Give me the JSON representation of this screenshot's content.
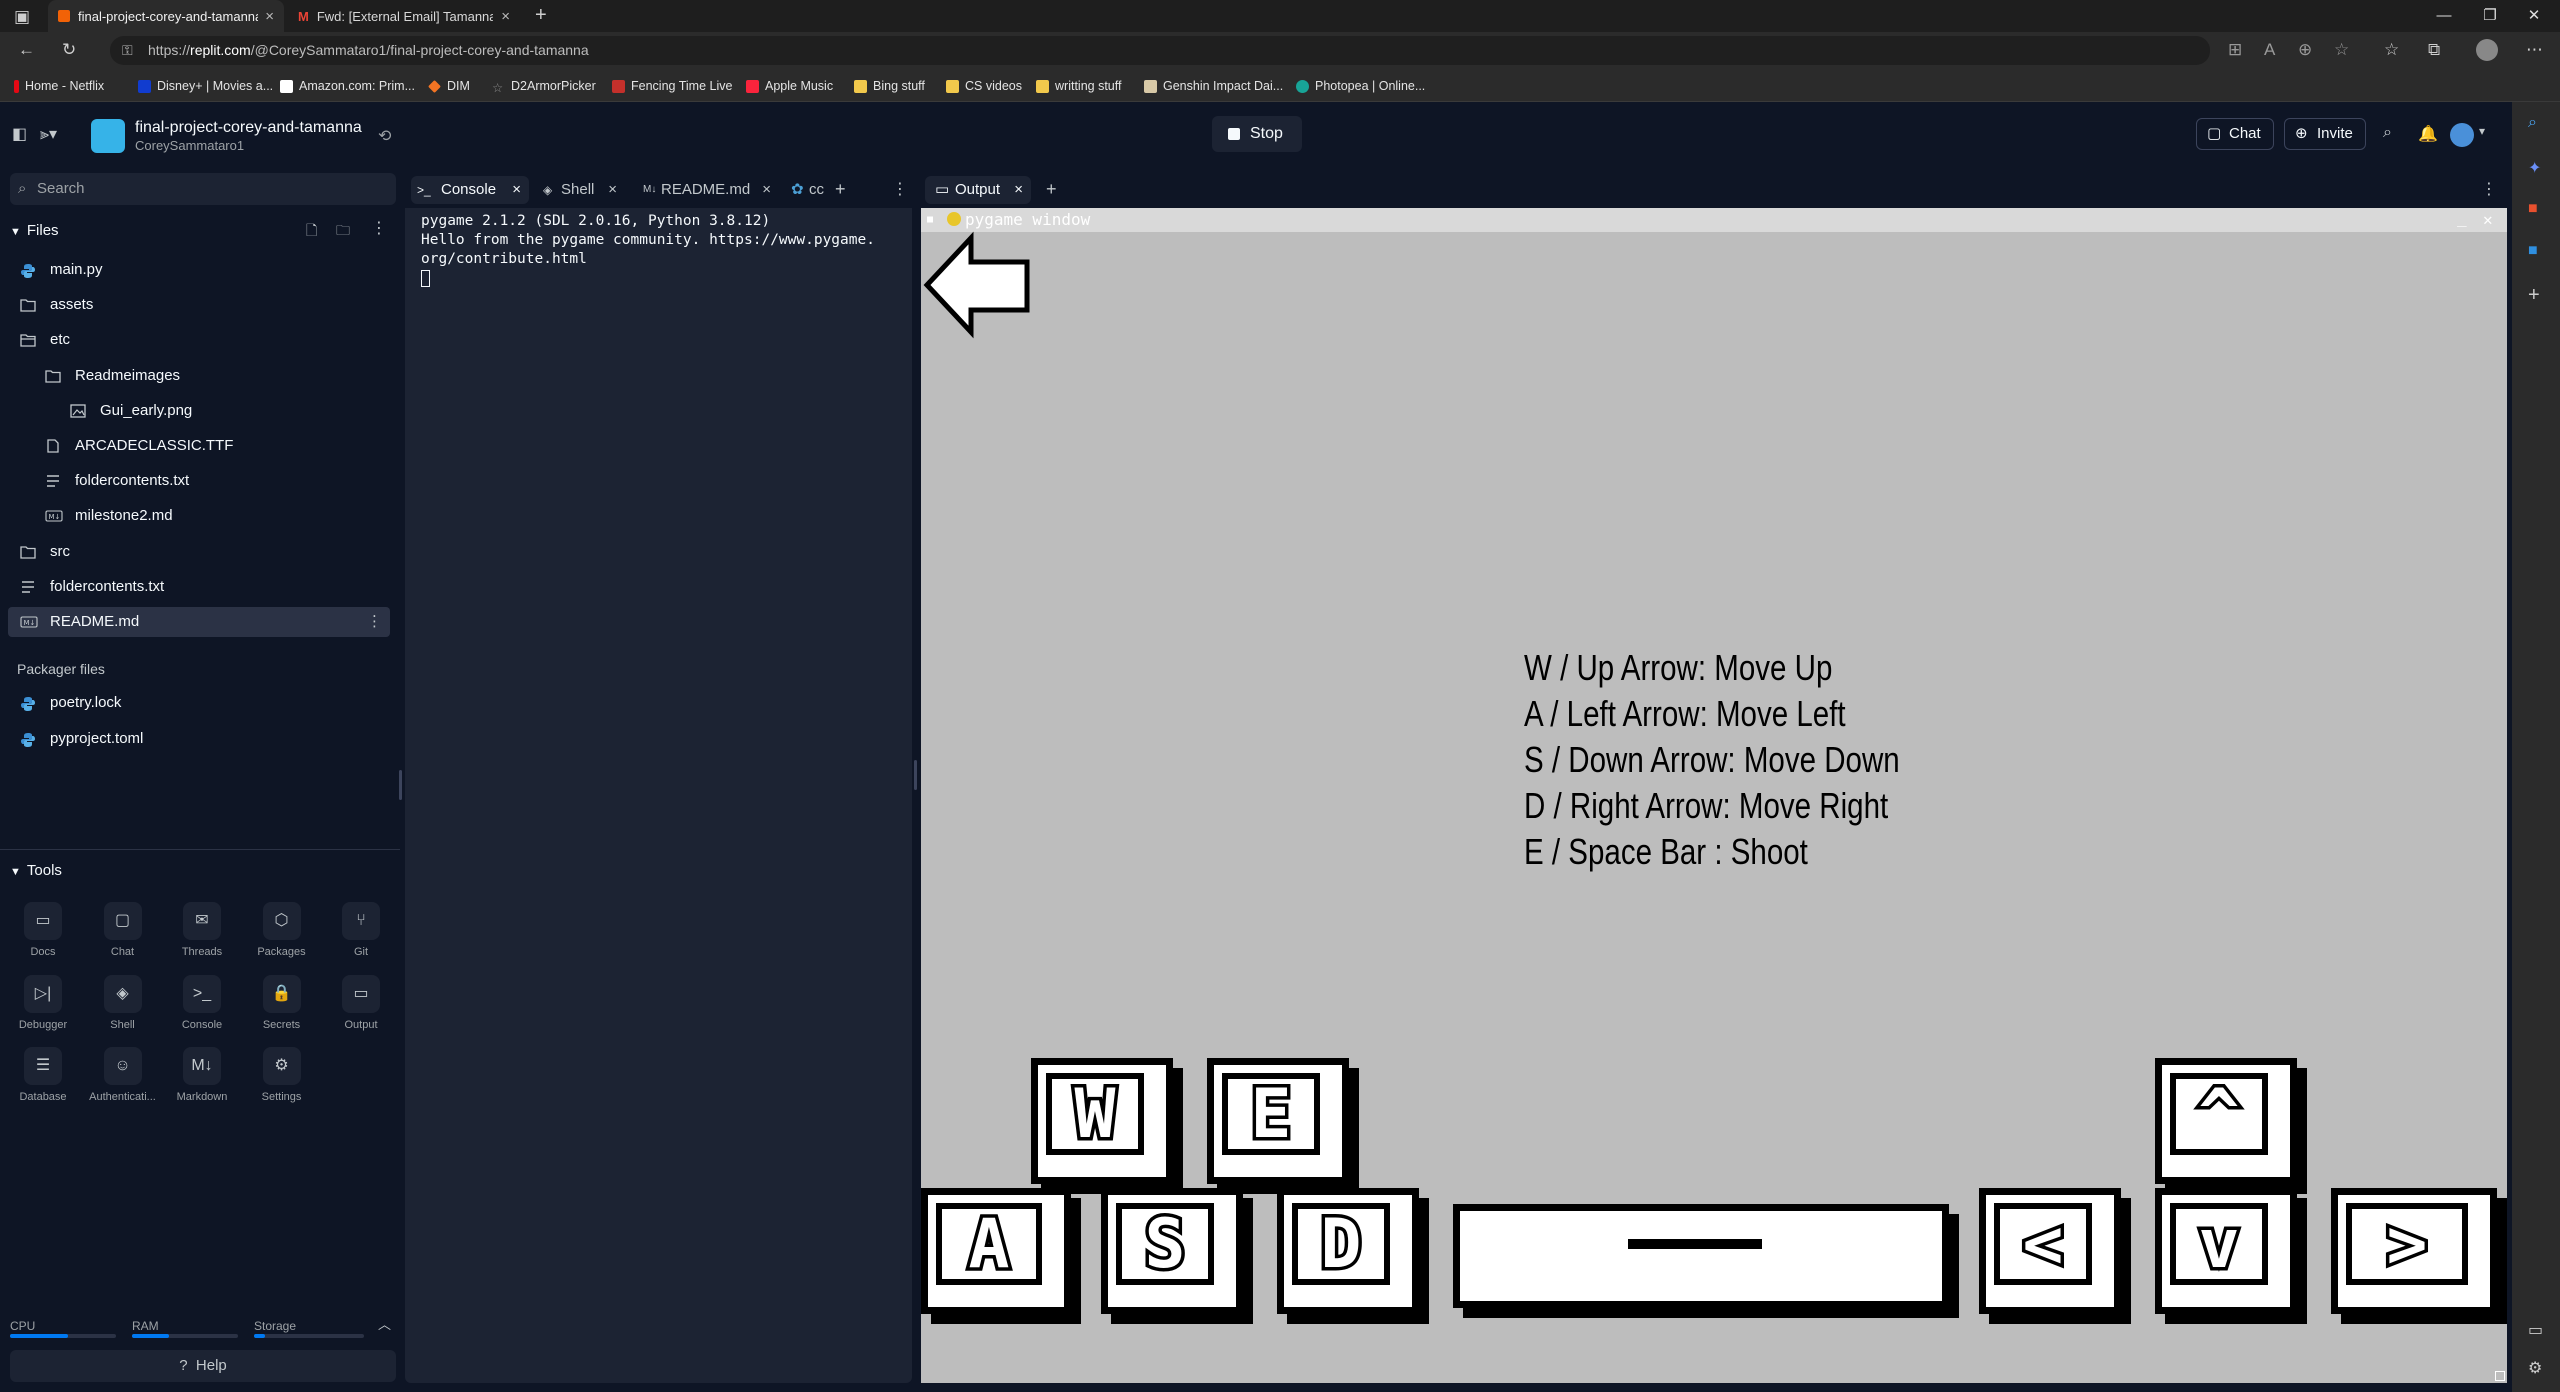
{
  "browser": {
    "tabs": [
      {
        "title": "final-project-corey-and-tamanna",
        "active": true
      },
      {
        "title": "Fwd: [External Email] Tamanna A...",
        "active": false
      }
    ],
    "new_tab": "+",
    "url_prefix": "https://",
    "url_host": "replit.com",
    "url_path": "/@CoreySammataro1/final-project-corey-and-tamanna",
    "bookmarks": [
      {
        "label": "Home - Netflix",
        "color": "#e50914"
      },
      {
        "label": "Disney+ | Movies a...",
        "color": "#113ccf"
      },
      {
        "label": "Amazon.com: Prim...",
        "color": "#ffffff"
      },
      {
        "label": "DIM",
        "color": "#f37423"
      },
      {
        "label": "D2ArmorPicker",
        "color": "#888888"
      },
      {
        "label": "Fencing Time Live",
        "color": "#c4302b"
      },
      {
        "label": "Apple Music",
        "color": "#fa243c"
      },
      {
        "label": "Bing stuff",
        "color": "#f2c94c"
      },
      {
        "label": "CS videos",
        "color": "#f2c94c"
      },
      {
        "label": "writting stuff",
        "color": "#f2c94c"
      },
      {
        "label": "Genshin Impact Dai...",
        "color": "#d8c9a7"
      },
      {
        "label": "Photopea | Online...",
        "color": "#18a497"
      }
    ]
  },
  "header": {
    "repo_name": "final-project-corey-and-tamanna",
    "repo_user": "CoreySammataro1",
    "stop_label": "Stop",
    "chat_label": "Chat",
    "invite_label": "Invite"
  },
  "sidebar": {
    "search_placeholder": "Search",
    "files_title": "Files",
    "files": [
      {
        "name": "main.py",
        "type": "python",
        "indent": 0
      },
      {
        "name": "assets",
        "type": "folder",
        "indent": 0
      },
      {
        "name": "etc",
        "type": "folder-open",
        "indent": 0
      },
      {
        "name": "Readmeimages",
        "type": "folder",
        "indent": 1
      },
      {
        "name": "Gui_early.png",
        "type": "image",
        "indent": 2
      },
      {
        "name": "ARCADECLASSIC.TTF",
        "type": "file",
        "indent": 1
      },
      {
        "name": "foldercontents.txt",
        "type": "text",
        "indent": 1
      },
      {
        "name": "milestone2.md",
        "type": "markdown",
        "indent": 1
      },
      {
        "name": "src",
        "type": "folder",
        "indent": 0
      },
      {
        "name": "foldercontents.txt",
        "type": "text",
        "indent": 0
      },
      {
        "name": "README.md",
        "type": "markdown",
        "indent": 0,
        "selected": true
      }
    ],
    "packager_title": "Packager files",
    "packager_files": [
      {
        "name": "poetry.lock",
        "type": "python"
      },
      {
        "name": "pyproject.toml",
        "type": "python"
      }
    ],
    "tools_title": "Tools",
    "tools": [
      {
        "label": "Docs",
        "icon": "docs-icon",
        "glyph": "▭"
      },
      {
        "label": "Chat",
        "icon": "chat-icon",
        "glyph": "▢"
      },
      {
        "label": "Threads",
        "icon": "threads-icon",
        "glyph": "✉"
      },
      {
        "label": "Packages",
        "icon": "packages-icon",
        "glyph": "⬡"
      },
      {
        "label": "Git",
        "icon": "git-icon",
        "glyph": "⑂"
      },
      {
        "label": "Debugger",
        "icon": "debugger-icon",
        "glyph": "▷|"
      },
      {
        "label": "Shell",
        "icon": "shell-icon",
        "glyph": "◈"
      },
      {
        "label": "Console",
        "icon": "console-icon",
        "glyph": ">_"
      },
      {
        "label": "Secrets",
        "icon": "lock-icon",
        "glyph": "🔒"
      },
      {
        "label": "Output",
        "icon": "monitor-icon",
        "glyph": "▭"
      },
      {
        "label": "Database",
        "icon": "database-icon",
        "glyph": "☰"
      },
      {
        "label": "Authenticati...",
        "icon": "user-icon",
        "glyph": "☺"
      },
      {
        "label": "Markdown",
        "icon": "markdown-icon",
        "glyph": "M↓"
      },
      {
        "label": "Settings",
        "icon": "gear-icon",
        "glyph": "⚙"
      }
    ],
    "meters": {
      "cpu_label": "CPU",
      "ram_label": "RAM",
      "storage_label": "Storage",
      "cpu": 0.55,
      "ram": 0.35,
      "storage": 0.1
    },
    "help_label": "Help"
  },
  "left_pane": {
    "tabs": [
      {
        "label": "Console",
        "active": true
      },
      {
        "label": "Shell",
        "active": false
      },
      {
        "label": "README.md",
        "active": false
      },
      {
        "label": "cc",
        "active": false
      }
    ],
    "console_lines": [
      "pygame 2.1.2 (SDL 2.0.16, Python 3.8.12)",
      "Hello from the pygame community. https://www.pygame.",
      "org/contribute.html"
    ]
  },
  "right_pane": {
    "tabs": [
      {
        "label": "Output",
        "active": true
      }
    ],
    "game_window_title": "pygame window",
    "instructions": [
      "W / Up Arrow: Move Up",
      "A / Left Arrow: Move Left",
      "S / Down Arrow: Move Down",
      "D / Right Arrow: Move Right",
      "E / Space Bar : Shoot"
    ],
    "keys": [
      "W",
      "E",
      "A",
      "S",
      "D",
      "^",
      "<",
      "v",
      ">"
    ]
  }
}
